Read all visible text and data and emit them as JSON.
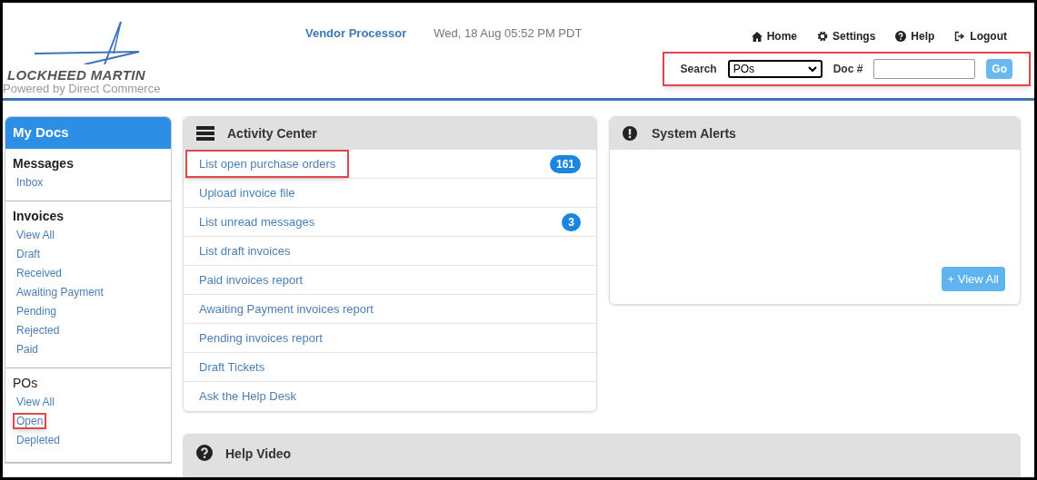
{
  "header": {
    "brand": "LOCKHEED MARTIN",
    "tagline": "Powered by Direct Commerce",
    "app_title": "Vendor Processor",
    "datetime": "Wed, 18 Aug 05:52 PM PDT",
    "nav": [
      {
        "kind": "home",
        "label": "Home"
      },
      {
        "kind": "settings",
        "label": "Settings"
      },
      {
        "kind": "help",
        "label": "Help"
      },
      {
        "kind": "logout",
        "label": "Logout"
      }
    ],
    "search": {
      "highlighted": true,
      "label": "Search",
      "type_value": "POs",
      "doc_label": "Doc #",
      "button": "Go"
    }
  },
  "sidebar": {
    "title": "My Docs",
    "sections": [
      {
        "heading": "Messages",
        "items": [
          {
            "label": "Inbox",
            "highlighted": false
          }
        ]
      },
      {
        "heading": "Invoices",
        "items": [
          {
            "label": "View All",
            "highlighted": false
          },
          {
            "label": "Draft",
            "highlighted": false
          },
          {
            "label": "Received",
            "highlighted": false
          },
          {
            "label": "Awaiting Payment",
            "highlighted": false
          },
          {
            "label": "Pending",
            "highlighted": false
          },
          {
            "label": "Rejected",
            "highlighted": false
          },
          {
            "label": "Paid",
            "highlighted": false
          }
        ]
      },
      {
        "heading": "POs",
        "items": [
          {
            "label": "View All",
            "highlighted": false
          },
          {
            "label": "Open",
            "highlighted": true
          },
          {
            "label": "Depleted",
            "highlighted": false
          }
        ]
      }
    ]
  },
  "activity_center": {
    "title": "Activity Center",
    "items": [
      {
        "label": "List open purchase orders",
        "count": "161",
        "highlighted": true
      },
      {
        "label": "Upload invoice file",
        "highlighted": false
      },
      {
        "label": "List unread messages",
        "count": "3",
        "highlighted": false
      },
      {
        "label": "List draft invoices",
        "highlighted": false
      },
      {
        "label": "Paid invoices report",
        "highlighted": false
      },
      {
        "label": "Awaiting Payment invoices report",
        "highlighted": false
      },
      {
        "label": "Pending invoices report",
        "highlighted": false
      },
      {
        "label": "Draft Tickets",
        "highlighted": false
      },
      {
        "label": "Ask the Help Desk",
        "highlighted": false
      }
    ]
  },
  "system_alerts": {
    "title": "System Alerts",
    "button": "+ View All"
  },
  "help_video": {
    "title": "Help Video"
  }
}
